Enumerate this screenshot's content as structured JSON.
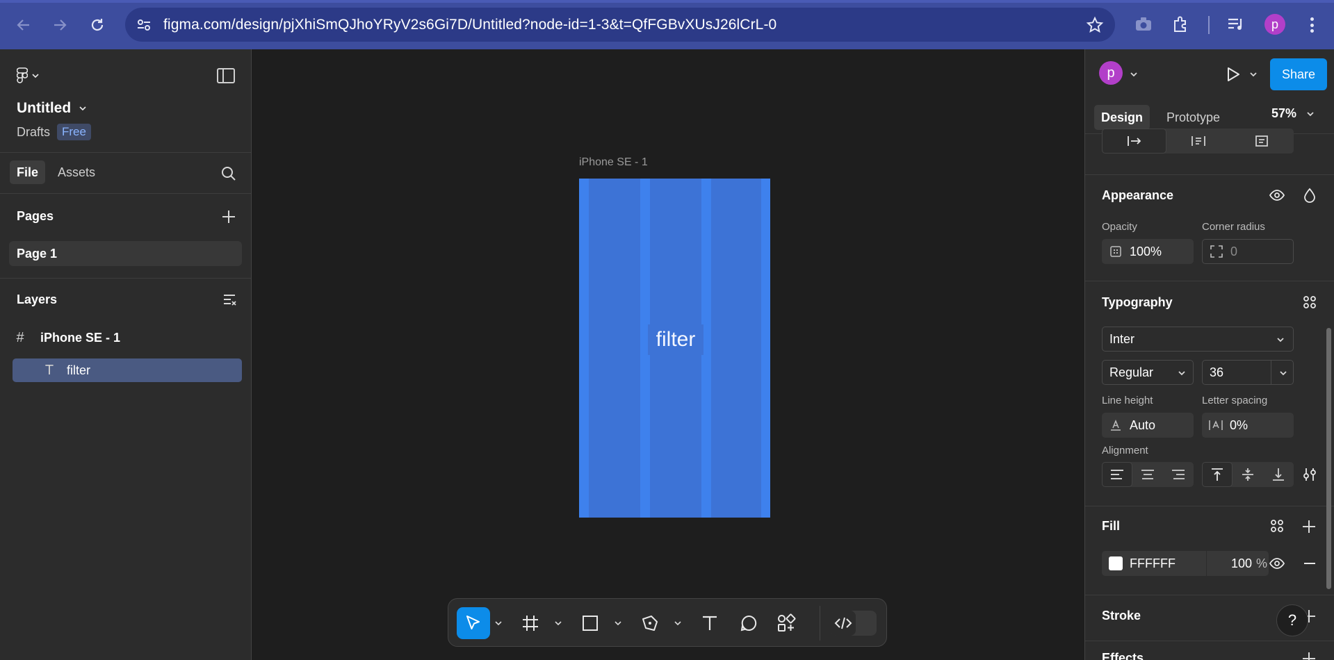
{
  "browser": {
    "url": "figma.com/design/pjXhiSmQJhoYRyV2s6Gi7D/Untitled?node-id=1-3&t=QfFGBvXUsJ26lCrL-0",
    "profile_initial": "p"
  },
  "left_panel": {
    "file_title": "Untitled",
    "location": "Drafts",
    "plan_badge": "Free",
    "tabs": [
      {
        "label": "File",
        "active": true
      },
      {
        "label": "Assets",
        "active": false
      }
    ],
    "pages_heading": "Pages",
    "pages": [
      {
        "label": "Page 1",
        "selected": true
      }
    ],
    "layers_heading": "Layers",
    "layers": [
      {
        "label": "iPhone SE - 1",
        "icon": "frame-icon",
        "selected": false
      },
      {
        "label": "filter",
        "icon": "text-icon",
        "selected": true
      }
    ]
  },
  "canvas": {
    "frame_label": "iPhone SE - 1",
    "frame_text": "filter",
    "frame_color": "#3b78dd"
  },
  "toolbar": {
    "tools": [
      "move-tool",
      "frame-tool",
      "rectangle-tool",
      "pen-tool",
      "text-tool",
      "comment-tool",
      "actions-tool"
    ],
    "active_tool": "move-tool",
    "dev_mode": "dev-mode-toggle"
  },
  "right_panel": {
    "avatar_initial": "p",
    "share_label": "Share",
    "tabs": [
      {
        "label": "Design",
        "active": true
      },
      {
        "label": "Prototype",
        "active": false
      }
    ],
    "zoom": "57%",
    "appearance": {
      "heading": "Appearance",
      "opacity_label": "Opacity",
      "opacity_value": "100%",
      "corner_radius_label": "Corner radius",
      "corner_radius_value": "0"
    },
    "typography": {
      "heading": "Typography",
      "font_family": "Inter",
      "font_weight": "Regular",
      "font_size": "36",
      "line_height_label": "Line height",
      "line_height_value": "Auto",
      "letter_spacing_label": "Letter spacing",
      "letter_spacing_value": "0%",
      "alignment_label": "Alignment"
    },
    "fill": {
      "heading": "Fill",
      "hex": "FFFFFF",
      "opacity": "100",
      "unit": "%"
    },
    "stroke_heading": "Stroke",
    "effects_heading": "Effects",
    "help_label": "?"
  },
  "colors": {
    "accent": "#0c8ce9",
    "chrome": "#3d4d9e",
    "panel": "#2c2c2c",
    "canvas": "#1e1e1e"
  }
}
